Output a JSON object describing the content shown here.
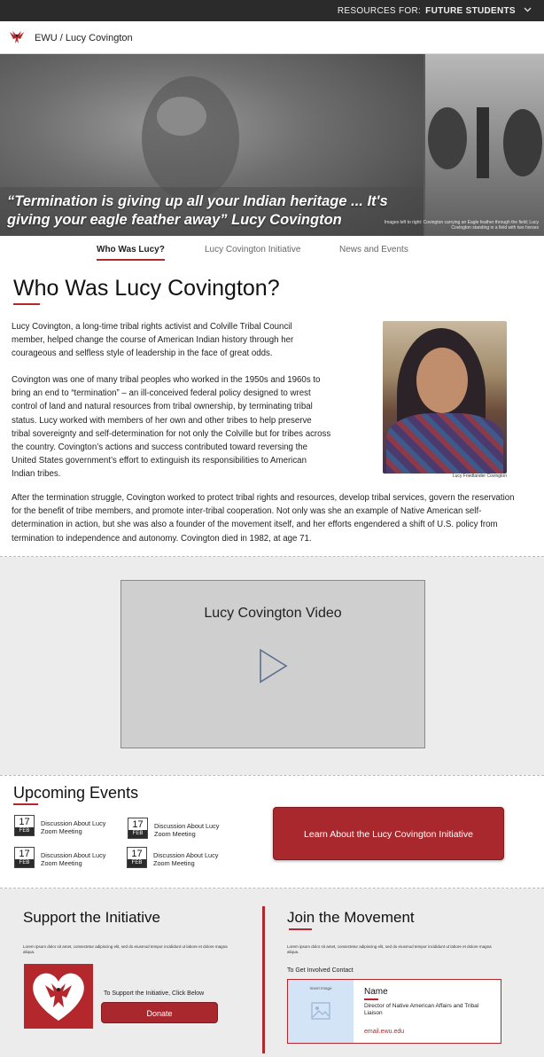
{
  "topbar": {
    "prefix": "RESOURCES FOR:",
    "audience": "FUTURE STUDENTS"
  },
  "brand": {
    "breadcrumb": "EWU / Lucy Covington"
  },
  "hero": {
    "quote": "“Termination is giving up all your Indian heritage ... It's giving your eagle feather away” Lucy Covington",
    "caption": "Images left to right: Covington carrying an Eagle feather through the field; Lucy Covington standing in a field with two horses"
  },
  "tabs": [
    {
      "label": "Who Was Lucy?",
      "active": true
    },
    {
      "label": "Lucy Covington Initiative",
      "active": false
    },
    {
      "label": "News and Events",
      "active": false
    }
  ],
  "main": {
    "title": "Who Was Lucy Covington?",
    "p1": "Lucy Covington, a long-time tribal rights activist and Colville Tribal Council member, helped change the course of American Indian history through her courageous and selfless style of leadership in the face of great odds.",
    "p2": "Covington was one of many tribal peoples who worked in the 1950s and 1960s to bring an end to “termination” – an ill-conceived federal policy designed to wrest control of land and natural resources from tribal ownership, by terminating tribal status. Lucy worked with members of her own and other tribes to help preserve tribal sovereignty and self-determination for not only the Colville but for tribes across the country. Covington’s actions and success contributed toward reversing the United States government’s effort to extinguish its responsibilities to American Indian tribes.",
    "p3": "After the termination struggle, Covington worked to protect tribal rights and resources, develop tribal services, govern the reservation for the benefit of tribe members, and promote inter-tribal cooperation. Not only was she an example of Native American self-determination in action, but she was also a founder of the movement itself, and her efforts engendered a shift of U.S. policy from termination to independence and autonomy. Covington died in 1982, at age 71.",
    "portrait_caption": "Lucy Friedlander Covington"
  },
  "video": {
    "title": "Lucy Covington Video"
  },
  "events": {
    "title": "Upcoming Events",
    "items": [
      {
        "day": "17",
        "month": "FEB",
        "line1": "Discussion About Lucy",
        "line2": "Zoom Meeting"
      },
      {
        "day": "17",
        "month": "FEB",
        "line1": "Discussion About Lucy",
        "line2": "Zoom Meeting"
      },
      {
        "day": "17",
        "month": "FEB",
        "line1": "Discussion About Lucy",
        "line2": "Zoom Meeting"
      },
      {
        "day": "17",
        "month": "FEB",
        "line1": "Discussion About Lucy",
        "line2": "Zoom Meeting"
      }
    ],
    "cta": "Learn About the Lucy Covington Initiative"
  },
  "support": {
    "title": "Support the Initiative",
    "lorem": "Lorem ipsum dolor sit amet, consectetur adipiscing elit, sed do eiusmod tempor incididunt ut labore et dolore magna aliqua.",
    "prompt": "To Support the Initiative, Click Below",
    "donate": "Donate"
  },
  "join": {
    "title": "Join the Movement",
    "lorem": "Lorem ipsum dolor sit amet, consectetur adipiscing elit, sed do eiusmod tempor incididunt ut labore et dolore magna aliqua.",
    "contact_label": "To Get Involved Contact",
    "insert_image": "Insert Image",
    "name": "Name",
    "role": "Director of Native American Affairs and Tribal Liaison",
    "email": "email.ewu.edu"
  },
  "colors": {
    "accent": "#b3272d",
    "topbar": "#2b2b2b",
    "band": "#ececec"
  }
}
